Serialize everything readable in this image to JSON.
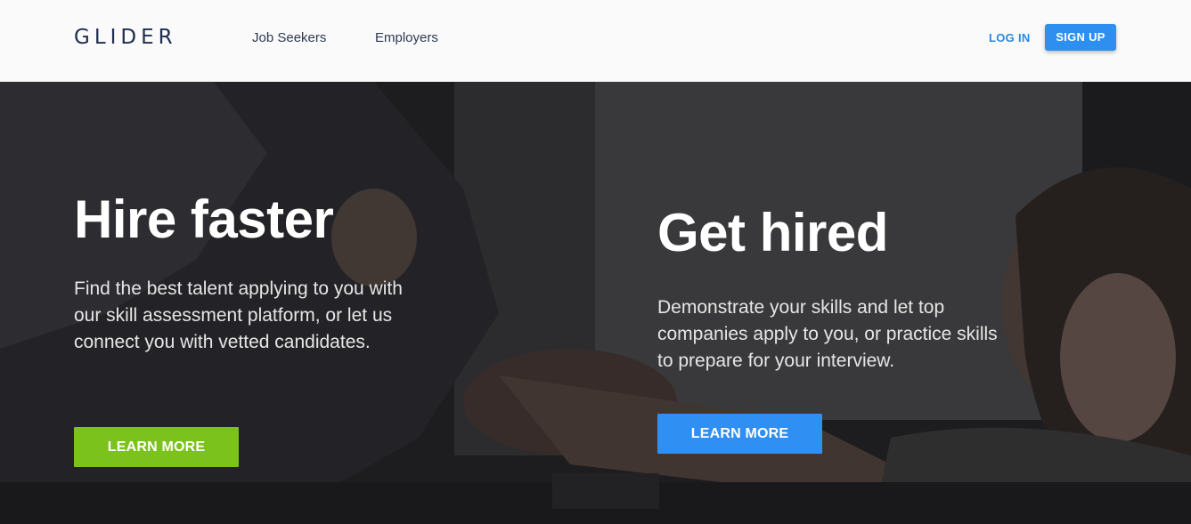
{
  "header": {
    "logo": "GLIDER",
    "nav": {
      "job_seekers": "Job Seekers",
      "employers": "Employers"
    },
    "login_label": "LOG IN",
    "signup_label": "SIGN UP"
  },
  "hero": {
    "left": {
      "title": "Hire faster",
      "text": "Find the best talent applying to you with our skill assessment platform, or let us connect you with vetted candidates.",
      "button_label": "LEARN MORE",
      "button_color": "#7cc21d"
    },
    "right": {
      "title": "Get hired",
      "text": "Demonstrate your skills and let top companies apply to you, or practice skills to prepare for your interview.",
      "button_label": "LEARN MORE",
      "button_color": "#2f8ff2"
    }
  },
  "colors": {
    "brand_dark": "#1f2d4e",
    "accent_blue": "#2e8ff0",
    "accent_green": "#7cc21d"
  }
}
